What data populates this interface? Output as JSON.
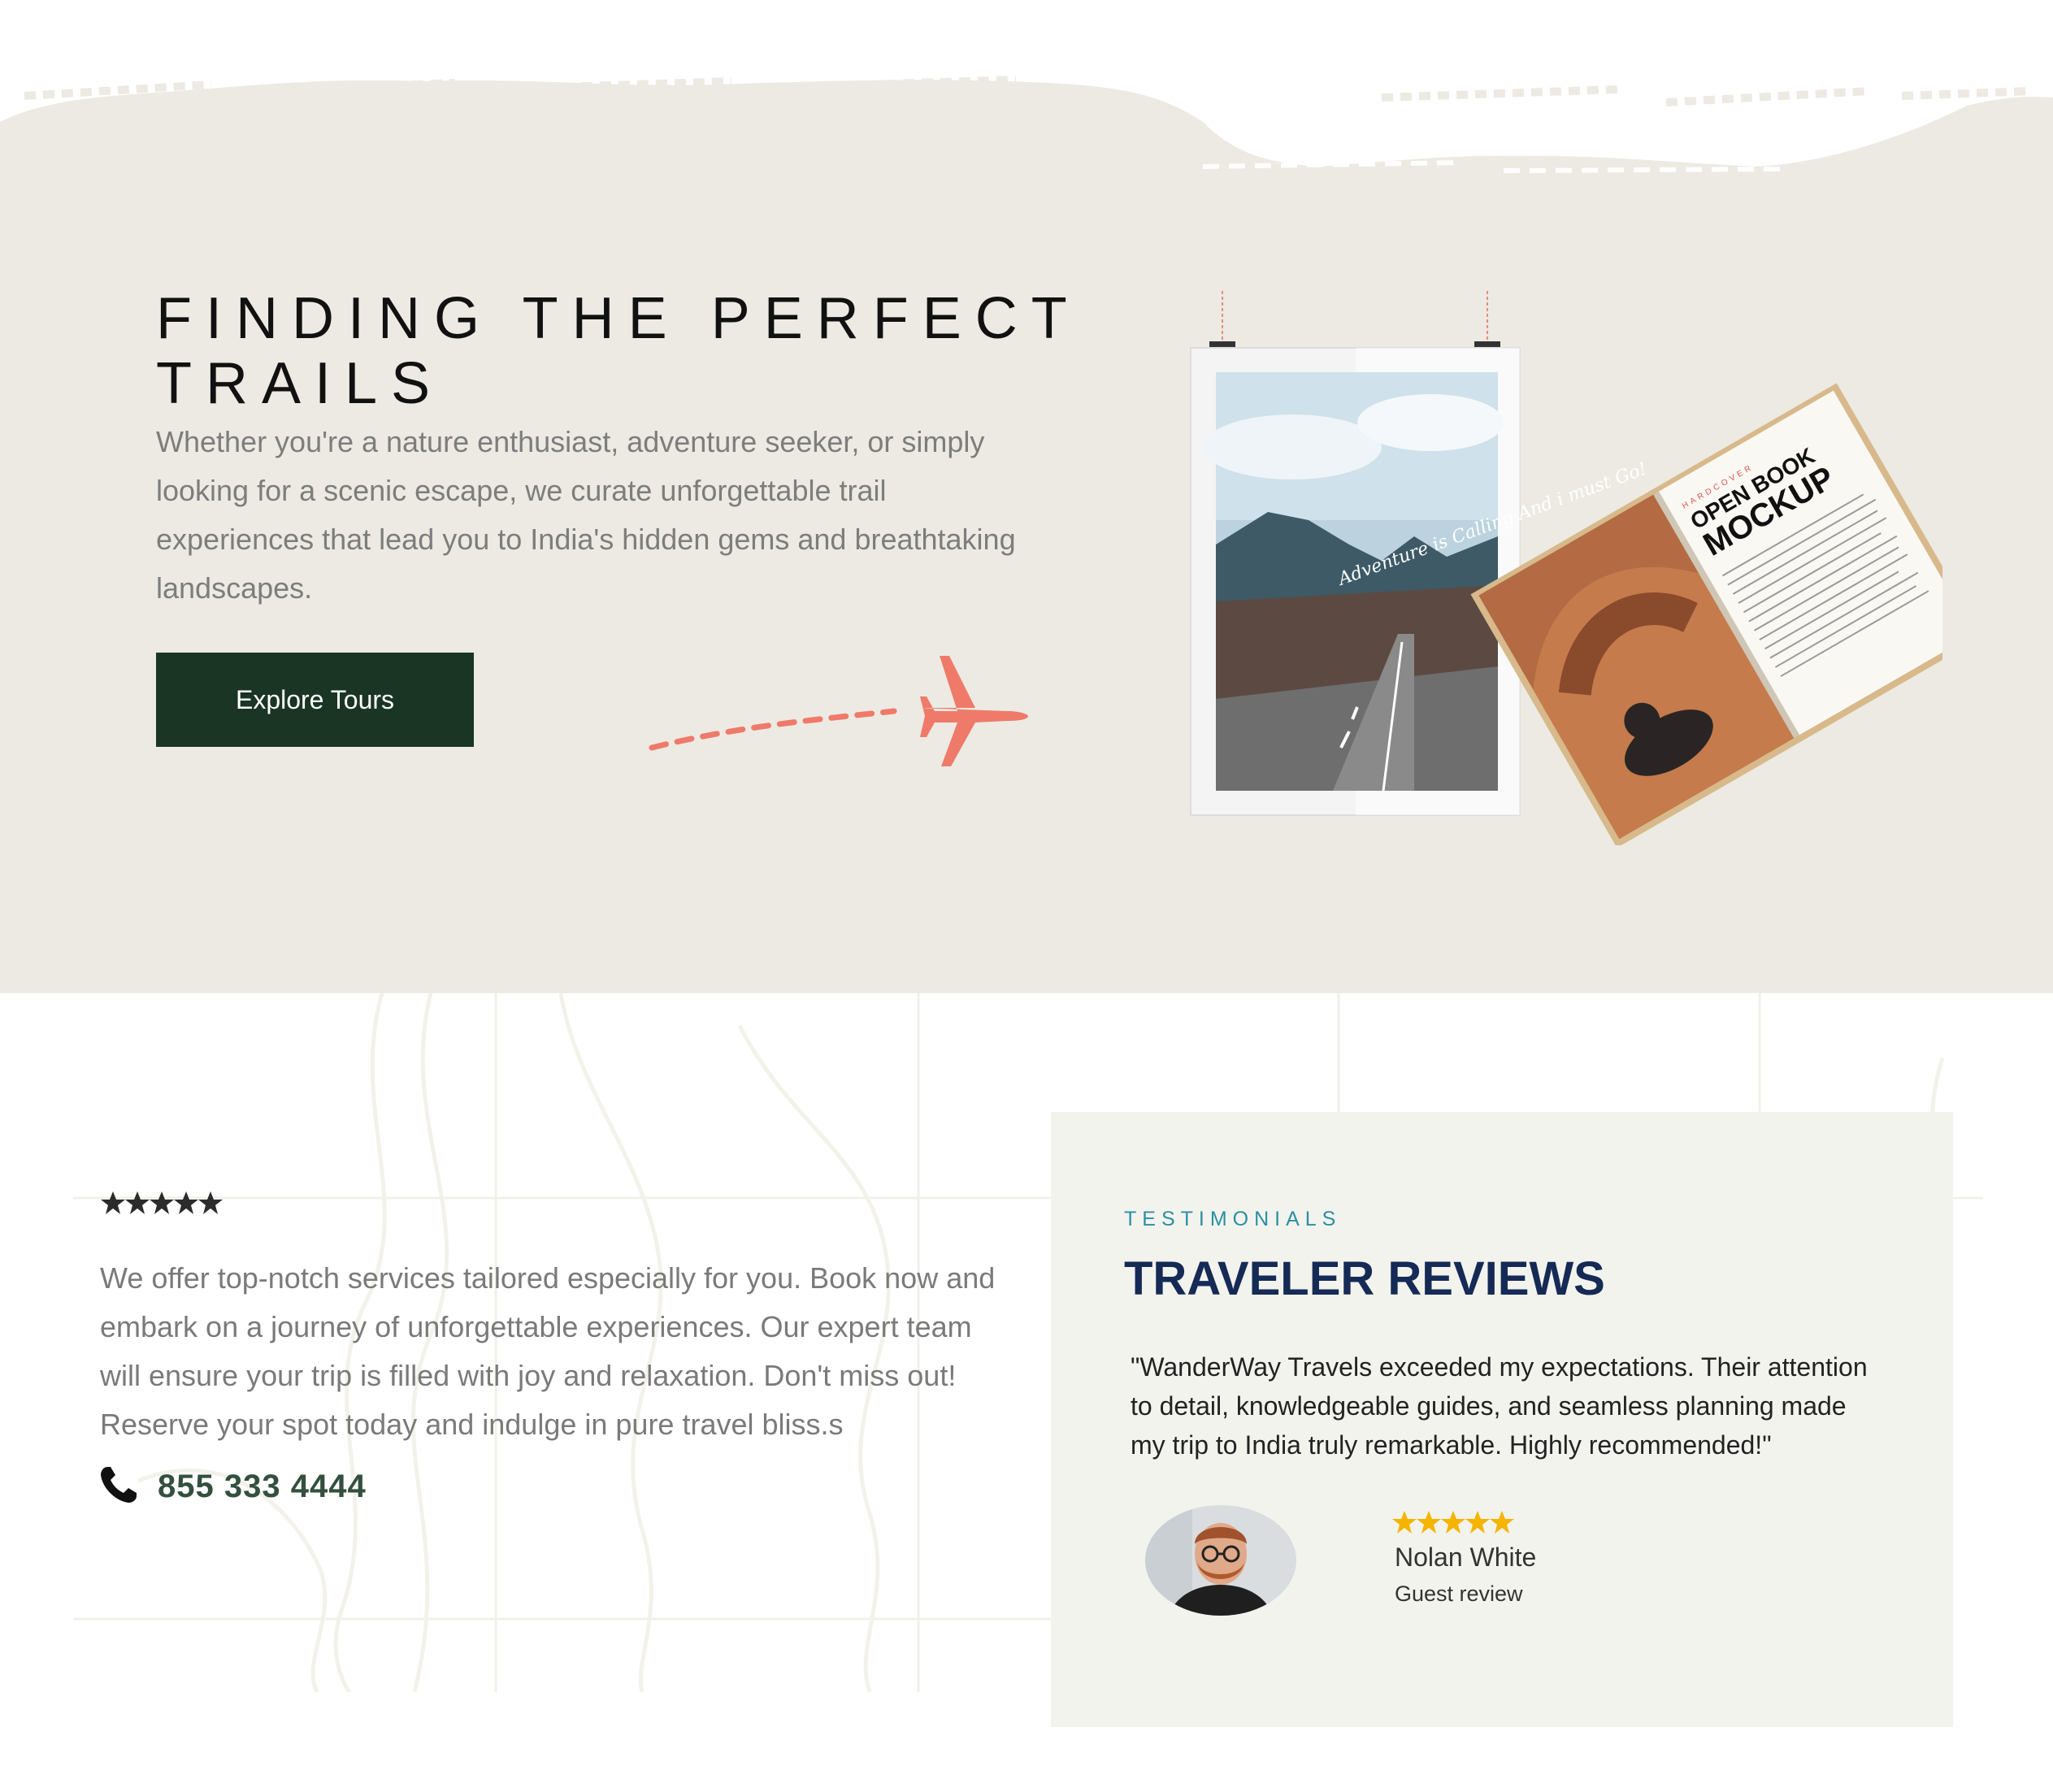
{
  "hero": {
    "title": "FINDING THE PERFECT TRAILS",
    "description": "Whether you're a nature enthusiast, adventure seeker, or simply looking for a scenic escape, we curate unforgettable trail experiences that lead you to India's hidden gems and breathtaking landscapes.",
    "button_label": "Explore Tours",
    "poster_text": "Adventure is Calling And i must Go!",
    "book_kicker": "HARDCOVER",
    "book_title_line1": "OPEN BOOK",
    "book_title_line2": "MOCKUP"
  },
  "services": {
    "rating_stars": 5,
    "text": "We offer top-notch services tailored especially for you. Book now and embark on a journey of unforgettable experiences. Our expert team will ensure your trip is filled with joy and relaxation. Don't miss out! Reserve your spot today and indulge in pure travel bliss.s",
    "phone": "855 333 4444"
  },
  "testimonials": {
    "eyebrow": "TESTIMONIALS",
    "title": "TRAVELER REVIEWS",
    "quote": "\"WanderWay Travels exceeded my expectations. Their attention to detail, knowledgeable guides, and seamless planning made my trip to India truly remarkable. Highly recommended!\"",
    "reviewer_name": "Nolan White",
    "reviewer_label": "Guest review",
    "rating_stars": 5
  },
  "colors": {
    "hero_bg": "#eceae2",
    "button_bg": "#1a3524",
    "accent_teal": "#2b8fa3",
    "title_navy": "#152a55",
    "plane": "#ef7a6a",
    "star_gold": "#f5b400",
    "card_bg": "#f3f3ee"
  },
  "icons": [
    "plane-icon",
    "phone-icon",
    "star-icon"
  ]
}
